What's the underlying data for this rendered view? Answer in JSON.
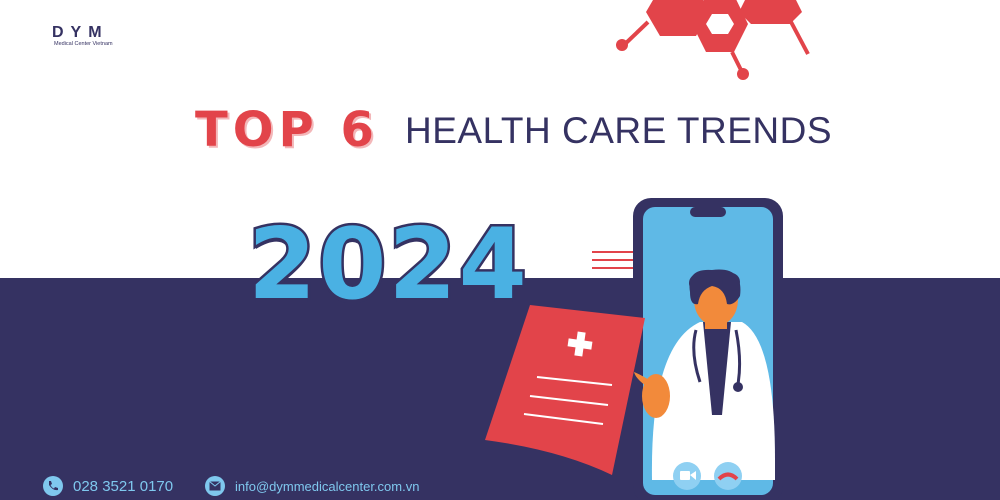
{
  "logo": {
    "mark": "DYM",
    "subtitle": "Medical Center Vietnam"
  },
  "headline": {
    "top": "TOP 6",
    "rest": "HEALTH CARE TRENDS",
    "year": "2024"
  },
  "contact": {
    "phone": "028 3521 0170",
    "email": "info@dymmedicalcenter.com.vn"
  },
  "icons": [
    "phone-icon",
    "mail-icon",
    "video-call-icon",
    "end-call-icon",
    "medical-cross-icon",
    "chat-bubble-icon"
  ],
  "colors": {
    "navy": "#353262",
    "red": "#e2444a",
    "sky": "#4ab1e3",
    "light_blue": "#7fc8ee",
    "white": "#ffffff"
  }
}
